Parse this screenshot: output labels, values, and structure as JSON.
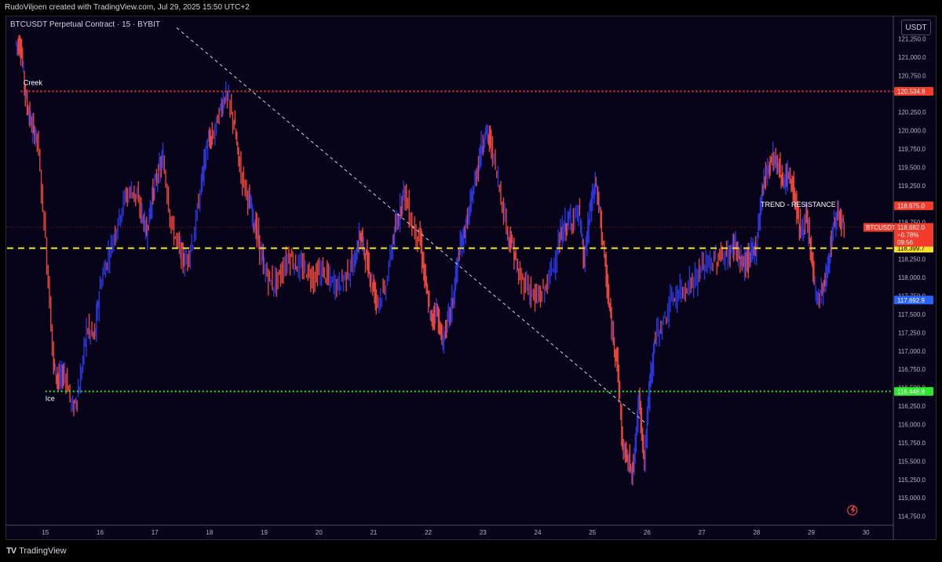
{
  "header": {
    "credit": "RudoViljoen created with TradingView.com, Jul 29, 2025 15:50 UTC+2",
    "symbol": "BTCUSDT Perpetual Contract · 15 · BYBIT",
    "currency": "USDT"
  },
  "footer": {
    "logo": "TV",
    "brand": "TradingView"
  },
  "colors": {
    "background": "#07041a",
    "candle_up": "#2b35d8",
    "candle_down": "#e8463c",
    "creek": "#f23b2a",
    "resistance": "#f5e12a",
    "ice": "#2ee62e",
    "trendline": "#d8d8e8",
    "last_price": "#f23b2a",
    "blue_tag": "#2962ff"
  },
  "chart_data": {
    "type": "line",
    "title": "BTCUSDT Perpetual Contract · 15 · BYBIT",
    "xlabel": "",
    "ylabel": "",
    "x_ticks": [
      "15",
      "16",
      "17",
      "18",
      "19",
      "20",
      "21",
      "22",
      "23",
      "24",
      "25",
      "26",
      "27",
      "28",
      "29",
      "30"
    ],
    "y_ticks": [
      "121,250.0",
      "121,000.0",
      "120,750.0",
      "120,250.0",
      "120,000.0",
      "119,750.0",
      "119,500.0",
      "119,250.0",
      "118,750.0",
      "118,250.0",
      "118,000.0",
      "117,750.0",
      "117,500.0",
      "117,250.0",
      "117,000.0",
      "116,750.0",
      "116,500.0",
      "116,250.0",
      "116,000.0",
      "115,750.0",
      "115,500.0",
      "115,250.0",
      "115,000.0",
      "114,750.0"
    ],
    "ylim": [
      114650,
      121500
    ],
    "xlim": [
      14.3,
      30.5
    ],
    "grid": false,
    "series": [
      {
        "x": [
          14.45,
          14.55,
          14.65,
          14.75,
          14.85,
          15.0,
          15.15,
          15.25,
          15.35,
          15.5,
          15.62,
          15.75,
          15.9,
          16.0,
          16.15,
          16.3,
          16.45,
          16.6,
          16.75,
          16.85,
          16.95,
          17.05,
          17.15,
          17.3,
          17.45,
          17.55,
          17.7,
          17.85,
          17.95,
          18.05,
          18.2,
          18.3,
          18.45,
          18.55,
          18.7,
          18.8,
          18.9,
          19.0,
          19.15,
          19.3,
          19.45,
          19.6,
          19.75,
          19.9,
          20.05,
          20.2,
          20.35,
          20.5,
          20.65,
          20.75,
          20.85,
          20.95,
          21.05,
          21.2,
          21.35,
          21.45,
          21.55,
          21.7,
          21.85,
          21.95,
          22.05,
          22.15,
          22.25,
          22.35,
          22.45,
          22.55,
          22.65,
          22.75,
          22.85,
          22.95,
          23.05,
          23.15,
          23.3,
          23.45,
          23.55,
          23.65,
          23.8,
          23.95,
          24.1,
          24.25,
          24.4,
          24.5,
          24.6,
          24.75,
          24.85,
          24.95,
          25.05,
          25.15,
          25.25,
          25.35,
          25.45,
          25.55,
          25.65,
          25.75,
          25.85,
          25.95,
          26.05,
          26.15,
          26.3,
          26.45,
          26.6,
          26.75,
          26.9,
          27.05,
          27.2,
          27.35,
          27.5,
          27.6,
          27.7,
          27.8,
          27.9,
          28.0,
          28.1,
          28.2,
          28.3,
          28.4,
          28.5,
          28.6,
          28.7,
          28.8,
          28.9,
          29.0,
          29.1,
          29.2,
          29.3,
          29.4,
          29.5,
          29.6
        ],
        "y": [
          121200,
          121150,
          120400,
          120050,
          119900,
          118500,
          116800,
          116600,
          116700,
          116200,
          116500,
          117300,
          117200,
          117900,
          118300,
          118700,
          119100,
          119200,
          118900,
          118600,
          119100,
          119400,
          119600,
          118700,
          118400,
          118200,
          118500,
          119300,
          119800,
          119900,
          120300,
          120500,
          120100,
          119500,
          119100,
          118800,
          118500,
          118100,
          117900,
          118050,
          118300,
          118150,
          118100,
          118000,
          118100,
          117950,
          117900,
          118050,
          118200,
          118600,
          118300,
          118000,
          117700,
          117800,
          118500,
          118800,
          119200,
          118700,
          118500,
          117900,
          117400,
          117600,
          117100,
          117400,
          117700,
          118300,
          118600,
          118900,
          119300,
          119700,
          120000,
          119800,
          119200,
          118600,
          118400,
          118000,
          117900,
          117700,
          117800,
          118100,
          118500,
          118700,
          118800,
          118900,
          118200,
          118900,
          119300,
          118800,
          118000,
          117300,
          116900,
          115700,
          115500,
          115400,
          116400,
          115500,
          116600,
          117200,
          117400,
          117700,
          117800,
          117900,
          118000,
          118200,
          118200,
          118300,
          118300,
          118500,
          118200,
          118200,
          118300,
          118450,
          119200,
          119500,
          119650,
          119500,
          119300,
          119400,
          119100,
          118600,
          118800,
          118300,
          117700,
          117800,
          118100,
          118700,
          118900,
          118700
        ]
      }
    ],
    "levels": [
      {
        "label": "Creek",
        "value": 120534.8,
        "tag": "120,534.8",
        "style": "dotted",
        "color": "#f23b2a"
      },
      {
        "label": "TREND - RESISTANCE",
        "value": 118399.7,
        "tag": "118,399.7",
        "style": "dashed",
        "color": "#f5e12a"
      },
      {
        "label": "Ice",
        "value": 116448.8,
        "tag": "116,448.8",
        "style": "dotted",
        "color": "#2ee62e"
      }
    ],
    "price_tags": [
      {
        "value": 118975.0,
        "text": "118,975.0",
        "bg": "#f23b2a",
        "fg": "#ffffff"
      },
      {
        "value": 117692.9,
        "text": "117,692.9",
        "bg": "#2962ff",
        "fg": "#ffffff"
      }
    ],
    "last_price": {
      "symbol": "BTCUSDT.P",
      "price": "118,682.0",
      "change": "−0.78%",
      "countdown": "09:56",
      "value": 118682.0
    },
    "trendline": {
      "x": [
        17.4,
        26.0
      ],
      "y": [
        121400,
        116000
      ]
    },
    "annotations": [
      {
        "text": "Creek",
        "x": 14.6,
        "y": 120620
      },
      {
        "text": "Ice",
        "x": 15.0,
        "y": 116320
      },
      {
        "text": "TREND - RESISTANCE",
        "x": 29.45,
        "y": 118960
      }
    ]
  }
}
